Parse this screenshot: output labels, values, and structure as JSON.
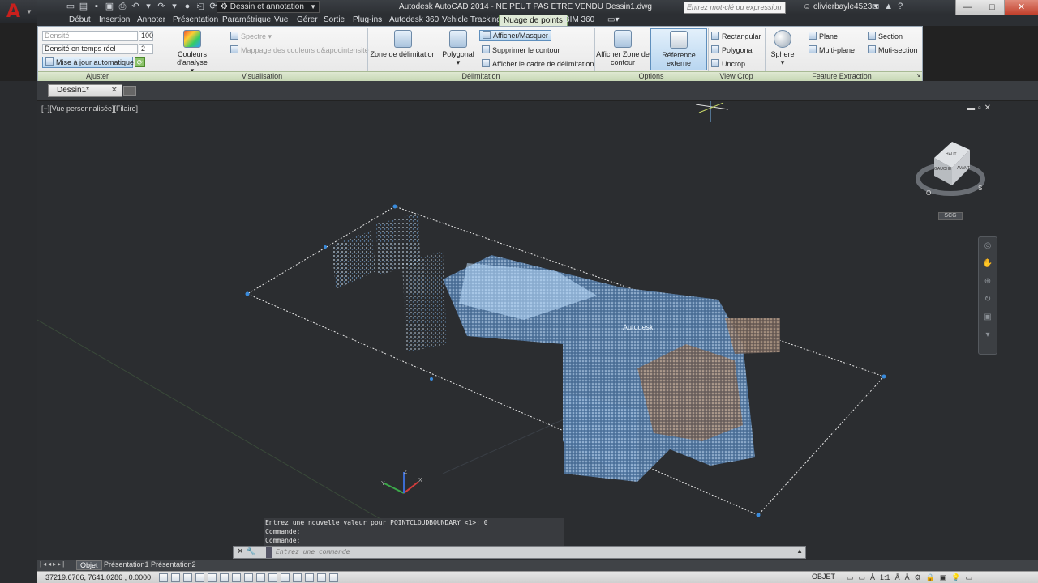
{
  "titlebar": {
    "workspace": "Dessin et annotation",
    "title": "Autodesk AutoCAD 2014 - NE PEUT PAS ETRE VENDU    Dessin1.dwg",
    "search_placeholder": "Entrez mot-clé ou expression",
    "user": "olivierbayle4523"
  },
  "menu_tabs": [
    "Début",
    "Insertion",
    "Annoter",
    "Présentation",
    "Paramétrique",
    "Vue",
    "Gérer",
    "Sortie",
    "Plug-ins",
    "Autodesk 360",
    "Vehicle Tracking",
    "Nuage de points",
    "BIM 360"
  ],
  "active_tab": "Nuage de points",
  "ribbon": {
    "ajuster": {
      "densite_label": "Densité",
      "densite_value": "100",
      "temps_reel_label": "Densité en temps réel",
      "temps_reel_value": "2",
      "mise_a_jour": "Mise à jour automatique",
      "panel": "Ajuster"
    },
    "visualisation": {
      "couleurs": "Couleurs d'analyse",
      "spectre": "Spectre",
      "mappage": "Mappage des couleurs d&apocintensité",
      "panel": "Visualisation"
    },
    "delimitation": {
      "zone": "Zone de délimitation",
      "polygonal": "Polygonal",
      "afficher_masquer": "Afficher/Masquer",
      "supprimer": "Supprimer le contour",
      "afficher_cadre": "Afficher le cadre de délimitation",
      "panel": "Délimitation"
    },
    "options": {
      "afficher_zone": "Afficher Zone de contour",
      "reference": "Référence externe",
      "panel": "Options"
    },
    "view_crop": {
      "rectangular": "Rectangular",
      "polygonal": "Polygonal",
      "uncrop": "Uncrop",
      "panel": "View Crop"
    },
    "feature": {
      "sphere": "Sphere",
      "plane": "Plane",
      "multi_plane": "Multi-plane",
      "section": "Section",
      "multi_section": "Muti-section",
      "panel": "Feature Extraction"
    }
  },
  "file_tab": "Dessin1*",
  "viewport": {
    "label": "[−][Vue personnalisée][Filaire]",
    "viewcube_top": "HAUT",
    "viewcube_left": "GAUCHE",
    "viewcube_right": "AVANT",
    "compass_o": "O",
    "compass_s": "S",
    "scg": "SCG",
    "point_cloud_label": "Autodesk"
  },
  "command": {
    "history": [
      "Entrez une nouvelle valeur pour POINTCLOUDBOUNDARY <1>: 0",
      "Commande:",
      "Commande:"
    ],
    "placeholder": "Entrez une commande"
  },
  "layout_tabs": [
    "Objet",
    "Présentation1",
    "Présentation2"
  ],
  "status": {
    "coords": "37219.6706, 7641.0286 , 0.0000",
    "objet": "OBJET",
    "scale": "1:1"
  }
}
